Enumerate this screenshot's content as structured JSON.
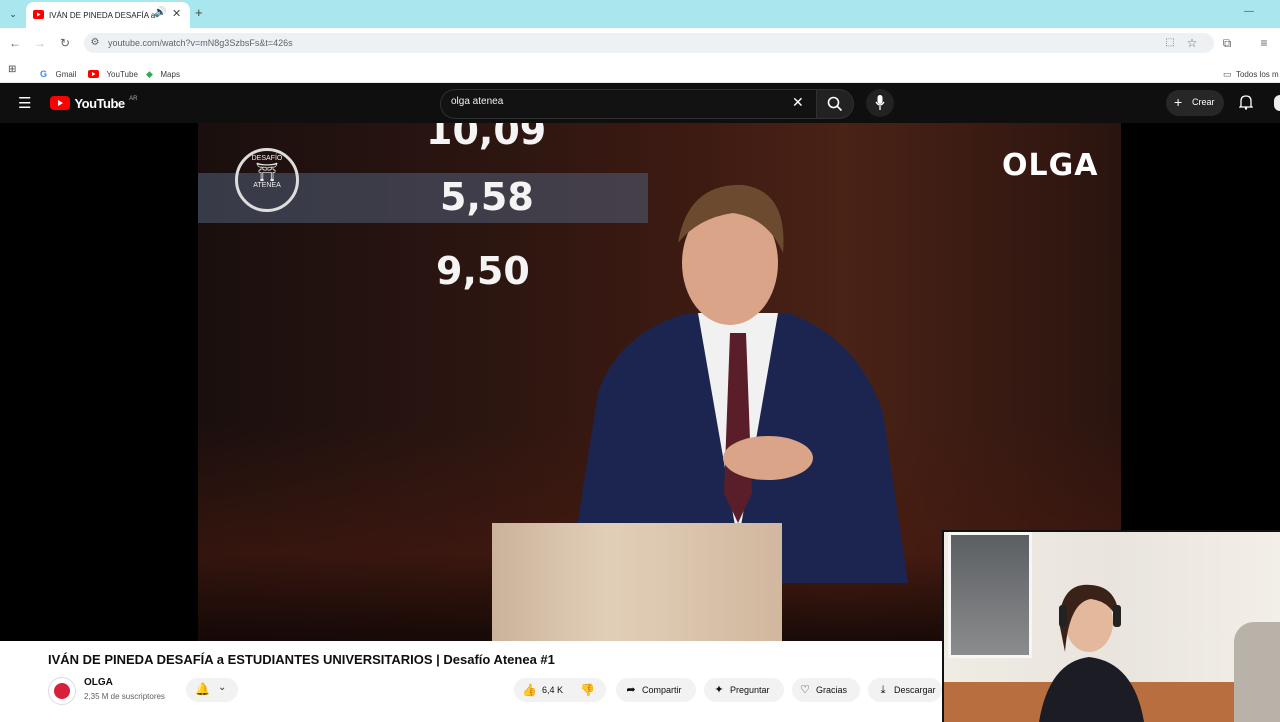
{
  "browser": {
    "tab_title": "IVÁN DE PINEDA DESAFÍA a",
    "url": "youtube.com/watch?v=mN8g3SzbsFs&t=426s",
    "bookmarks": [
      "Gmail",
      "YouTube",
      "Maps"
    ],
    "all_bookmarks": "Todos los m"
  },
  "youtube": {
    "logo_text": "YouTube",
    "region": "AR",
    "search_query": "olga atenea",
    "create_label": "Crear"
  },
  "video_frame": {
    "scores": [
      "10,09",
      "5,58",
      "9,50"
    ],
    "seal_top": "DESAFÍO",
    "seal_bottom": "ATENEA",
    "brand": "OLGA"
  },
  "video": {
    "title": "IVÁN DE PINEDA DESAFÍA a ESTUDIANTES UNIVERSITARIOS | Desafío Atenea #1",
    "channel": "OLGA",
    "subscribers": "2,35 M de suscriptores",
    "likes": "6,4 K",
    "share": "Compartir",
    "ask": "Preguntar",
    "thanks": "Gracias",
    "download": "Descargar"
  },
  "colors": {
    "tabstrip": "#a9e7ee",
    "yt_red": "#ff0000",
    "yt_header": "#0f0f0f"
  }
}
